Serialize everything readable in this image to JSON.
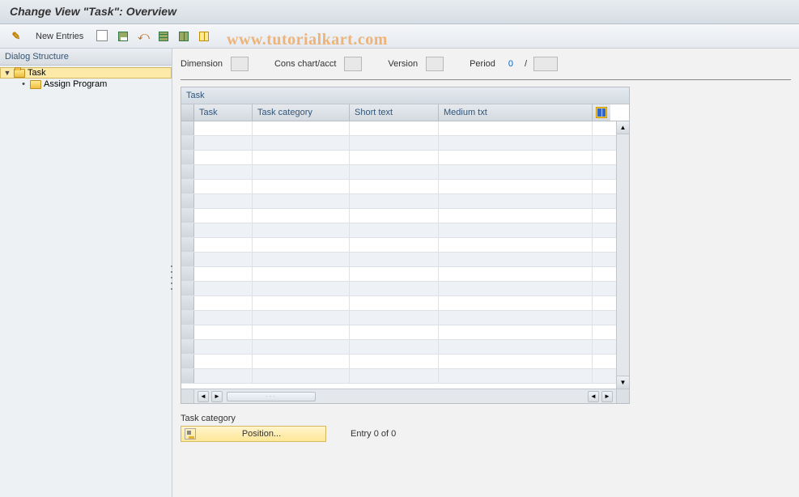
{
  "title": "Change View \"Task\": Overview",
  "watermark": "www.tutorialkart.com",
  "toolbar": {
    "new_entries": "New Entries"
  },
  "sidebar": {
    "header": "Dialog Structure",
    "items": [
      {
        "label": "Task",
        "selected": true,
        "expandable": true,
        "open": true
      },
      {
        "label": "Assign Program",
        "selected": false,
        "expandable": false
      }
    ]
  },
  "params": {
    "dimension": {
      "label": "Dimension",
      "value": ""
    },
    "cons_chart": {
      "label": "Cons chart/acct",
      "value": ""
    },
    "version": {
      "label": "Version",
      "value": ""
    },
    "period": {
      "label": "Period",
      "value_a": "0",
      "value_b": ""
    }
  },
  "grid": {
    "title": "Task",
    "columns": {
      "task": "Task",
      "task_category": "Task category",
      "short_text": "Short text",
      "medium_txt": "Medium txt"
    },
    "rows": []
  },
  "footer": {
    "category_label": "Task category",
    "position_label": "Position...",
    "entry_count": "Entry 0 of 0"
  }
}
